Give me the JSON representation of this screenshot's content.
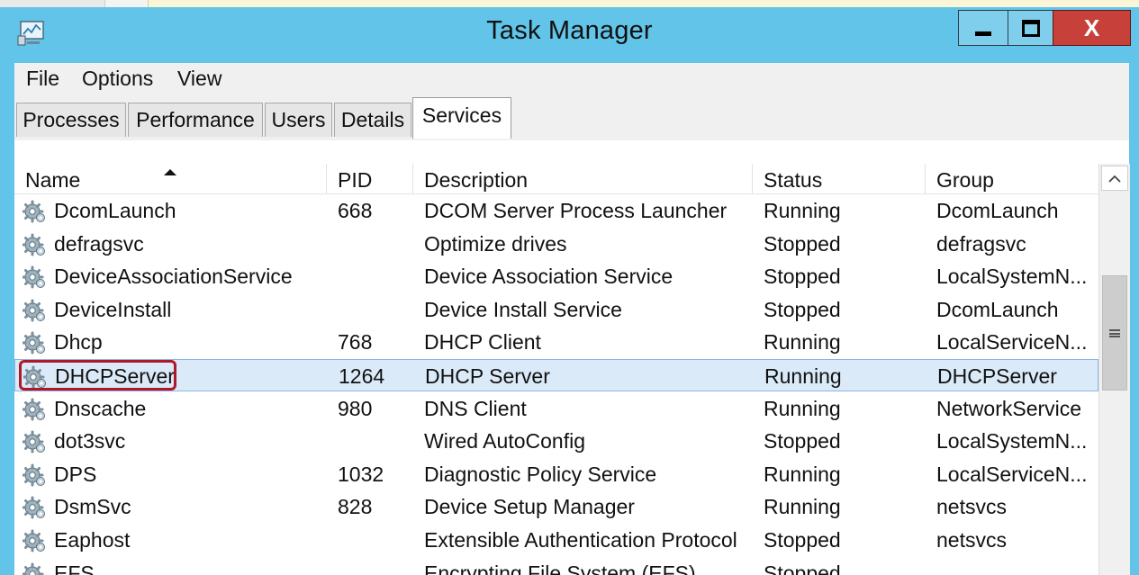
{
  "window": {
    "title": "Task Manager",
    "close_glyph": "X",
    "accent_color": "#61c4e8",
    "close_color": "#c8403a"
  },
  "menu": [
    "File",
    "Options",
    "View"
  ],
  "tabs": [
    {
      "label": "Processes",
      "active": false
    },
    {
      "label": "Performance",
      "active": false
    },
    {
      "label": "Users",
      "active": false
    },
    {
      "label": "Details",
      "active": false
    },
    {
      "label": "Services",
      "active": true
    }
  ],
  "columns": {
    "name": "Name",
    "pid": "PID",
    "description": "Description",
    "status": "Status",
    "group": "Group"
  },
  "sort": {
    "column": "Name",
    "direction": "ascending"
  },
  "rows": [
    {
      "name": "DcomLaunch",
      "pid": "668",
      "description": "DCOM Server Process Launcher",
      "status": "Running",
      "group": "DcomLaunch"
    },
    {
      "name": "defragsvc",
      "pid": "",
      "description": "Optimize drives",
      "status": "Stopped",
      "group": "defragsvc"
    },
    {
      "name": "DeviceAssociationService",
      "pid": "",
      "description": "Device Association Service",
      "status": "Stopped",
      "group": "LocalSystemN..."
    },
    {
      "name": "DeviceInstall",
      "pid": "",
      "description": "Device Install Service",
      "status": "Stopped",
      "group": "DcomLaunch"
    },
    {
      "name": "Dhcp",
      "pid": "768",
      "description": "DHCP Client",
      "status": "Running",
      "group": "LocalServiceN..."
    },
    {
      "name": "DHCPServer",
      "pid": "1264",
      "description": "DHCP Server",
      "status": "Running",
      "group": "DHCPServer"
    },
    {
      "name": "Dnscache",
      "pid": "980",
      "description": "DNS Client",
      "status": "Running",
      "group": "NetworkService"
    },
    {
      "name": "dot3svc",
      "pid": "",
      "description": "Wired AutoConfig",
      "status": "Stopped",
      "group": "LocalSystemN..."
    },
    {
      "name": "DPS",
      "pid": "1032",
      "description": "Diagnostic Policy Service",
      "status": "Running",
      "group": "LocalServiceN..."
    },
    {
      "name": "DsmSvc",
      "pid": "828",
      "description": "Device Setup Manager",
      "status": "Running",
      "group": "netsvcs"
    },
    {
      "name": "Eaphost",
      "pid": "",
      "description": "Extensible Authentication Protocol",
      "status": "Stopped",
      "group": "netsvcs"
    },
    {
      "name": "EFS",
      "pid": "",
      "description": "Encrypting File System (EFS)",
      "status": "Stopped",
      "group": ""
    }
  ],
  "selected_row": "DHCPServer",
  "highlight_color": "#b0182a",
  "icons": {
    "app": "task-manager-icon",
    "service": "gear-icon",
    "scroll_up": "chevron-up-icon",
    "scroll_grip": "grip-icon"
  }
}
